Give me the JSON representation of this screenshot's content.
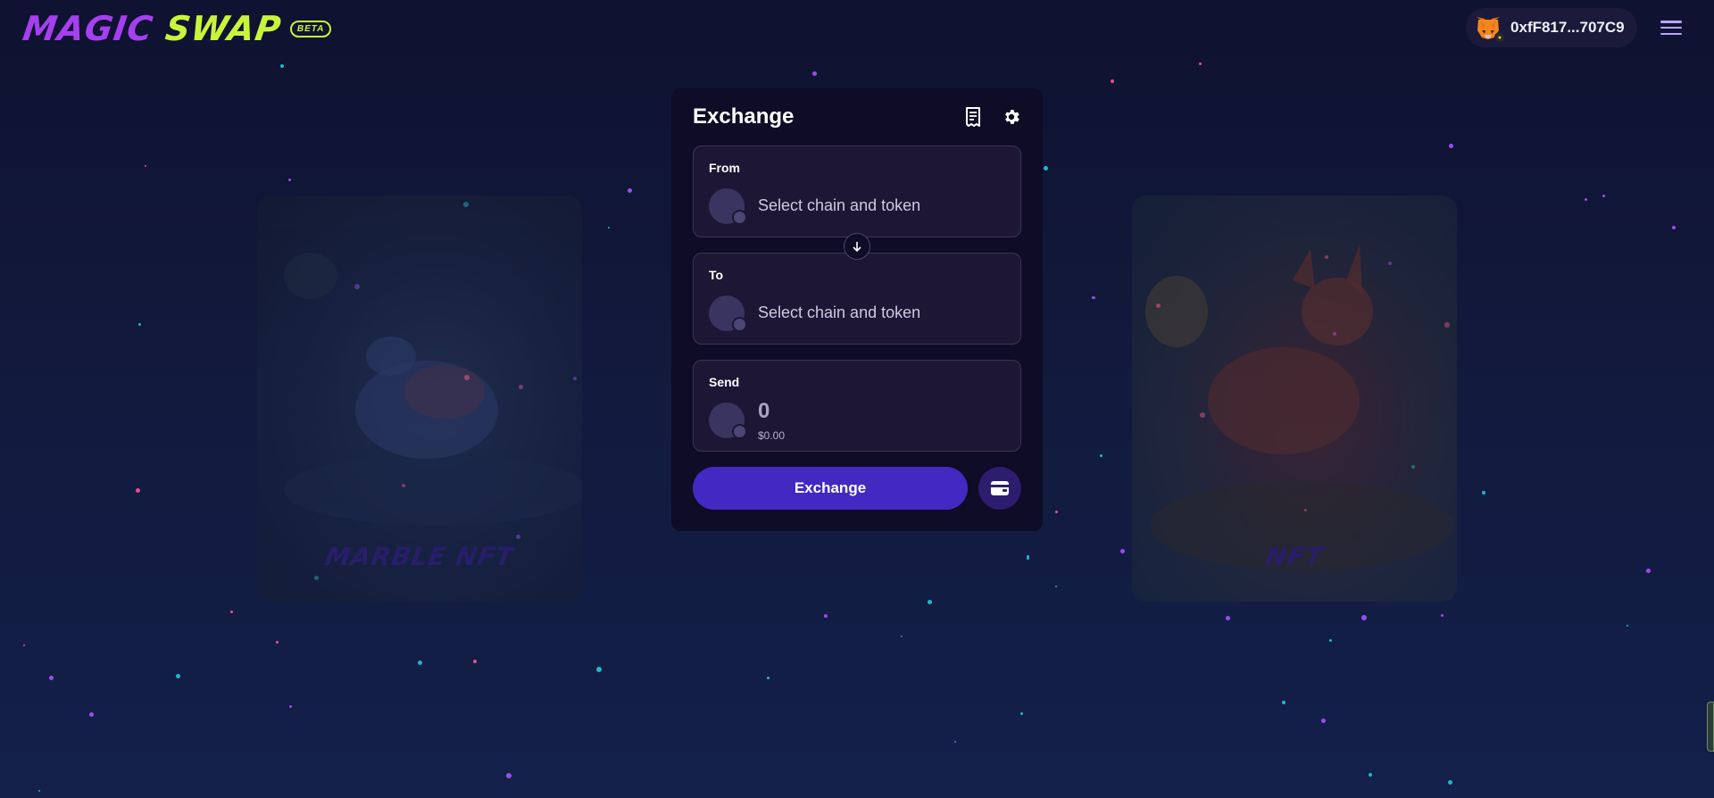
{
  "header": {
    "logo_word1": "MAGIC",
    "logo_word2": "SWAP",
    "beta_badge": "BETA",
    "wallet_address": "0xfF817...707C9",
    "menu_icon": "hamburger-menu-icon"
  },
  "nft_left": {
    "caption": "MARBLE NFT"
  },
  "nft_right": {
    "caption": "NFT"
  },
  "exchange": {
    "title": "Exchange",
    "history_icon": "receipt-icon",
    "settings_icon": "gear-icon",
    "from": {
      "label": "From",
      "placeholder": "Select chain and token"
    },
    "to": {
      "label": "To",
      "placeholder": "Select chain and token"
    },
    "send": {
      "label": "Send",
      "amount": "0",
      "usd": "$0.00"
    },
    "submit_label": "Exchange",
    "wallet_icon": "wallet-icon"
  },
  "colors": {
    "brand_purple": "#a53ff0",
    "brand_lime": "#c8f53b",
    "button_primary": "#4428c2",
    "panel_bg": "#0e0c26"
  }
}
